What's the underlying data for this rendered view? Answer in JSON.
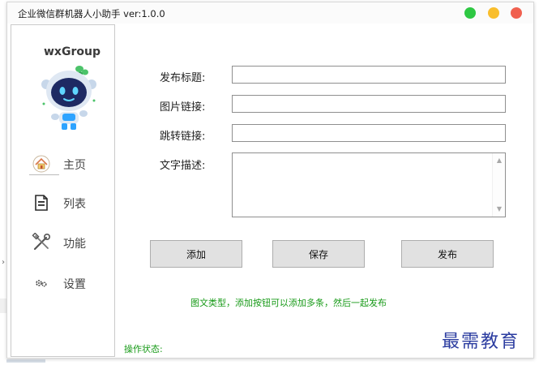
{
  "window": {
    "title": "企业微信群机器人小助手 ver:1.0.0",
    "controls": {
      "minimize_color": "#2ec843",
      "maximize_color": "#f9be2c",
      "close_color": "#f0604f"
    }
  },
  "sidebar": {
    "brand": "wxGroup",
    "mascot_icon": "robot-mascot-icon",
    "items": [
      {
        "label": "主页",
        "icon": "home-icon",
        "active": true
      },
      {
        "label": "列表",
        "icon": "list-document-icon"
      },
      {
        "label": "功能",
        "icon": "tools-icon"
      },
      {
        "label": "设置",
        "icon": "gears-icon"
      }
    ]
  },
  "form": {
    "title_label": "发布标题:",
    "title_value": "",
    "image_label": "图片链接:",
    "image_value": "",
    "jump_label": "跳转链接:",
    "jump_value": "",
    "desc_label": "文字描述:",
    "desc_value": ""
  },
  "buttons": {
    "add": "添加",
    "save": "保存",
    "publish": "发布"
  },
  "hint": "图文类型，添加按钮可以添加多条，然后一起发布",
  "status": {
    "label": "操作状态:",
    "value": ""
  },
  "watermark": "最需教育",
  "colors": {
    "hint_text": "#179a17",
    "watermark": "#2c3da0"
  }
}
